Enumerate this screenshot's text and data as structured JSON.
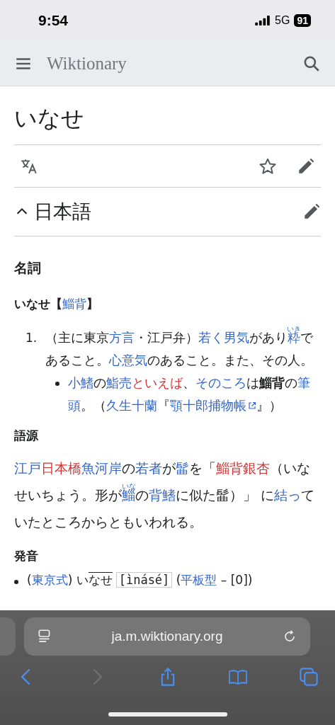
{
  "status_bar": {
    "time": "9:54",
    "network": "5G",
    "battery": "91"
  },
  "header": {
    "title": "Wiktionary"
  },
  "page": {
    "title": "いなせ"
  },
  "section": {
    "heading": "日本語",
    "expanded": true
  },
  "pos_heading": "名詞",
  "headword": [
    {
      "kind": "bold",
      "text": "いなせ【"
    },
    {
      "kind": "link",
      "text": "鯔背"
    },
    {
      "kind": "bold",
      "text": "】"
    }
  ],
  "definitions": [
    {
      "number": "1.",
      "segments": [
        {
          "kind": "text",
          "text": "（主に東京"
        },
        {
          "kind": "link",
          "text": "方言"
        },
        {
          "kind": "text",
          "text": "・江戸弁）"
        },
        {
          "kind": "link",
          "text": "若く男気"
        },
        {
          "kind": "text",
          "text": "があり"
        },
        {
          "kind": "link",
          "text": "粋",
          "ruby": "いき"
        },
        {
          "kind": "text",
          "text": "であること。"
        },
        {
          "kind": "link",
          "text": "心意気"
        },
        {
          "kind": "text",
          "text": "のあること。また、その人。"
        }
      ],
      "examples": [
        [
          {
            "kind": "link",
            "text": "小鰭"
          },
          {
            "kind": "text",
            "text": "の"
          },
          {
            "kind": "link",
            "text": "鮨売"
          },
          {
            "kind": "redlink",
            "text": "といえば"
          },
          {
            "kind": "text",
            "text": "、"
          },
          {
            "kind": "link",
            "text": "そのころ"
          },
          {
            "kind": "text",
            "text": "は"
          },
          {
            "kind": "bold",
            "text": "鯔背"
          },
          {
            "kind": "text",
            "text": "の"
          },
          {
            "kind": "link",
            "text": "筆"
          },
          {
            "kind": "link",
            "text": "頭"
          },
          {
            "kind": "text",
            "text": "。（"
          },
          {
            "kind": "link",
            "text": "久生十蘭"
          },
          {
            "kind": "text",
            "text": "『"
          },
          {
            "kind": "extlink",
            "text": "顎十郎捕物帳"
          },
          {
            "kind": "text",
            "text": "』）"
          }
        ]
      ]
    }
  ],
  "etymology": {
    "heading": "語源",
    "segments": [
      {
        "kind": "link",
        "text": "江戸"
      },
      {
        "kind": "redlink",
        "text": "日本橋"
      },
      {
        "kind": "link",
        "text": "魚河岸"
      },
      {
        "kind": "text",
        "text": "の"
      },
      {
        "kind": "link",
        "text": "若者"
      },
      {
        "kind": "text",
        "text": "が"
      },
      {
        "kind": "link",
        "text": "髷"
      },
      {
        "kind": "text",
        "text": "を「"
      },
      {
        "kind": "redlink",
        "text": "鯔背銀杏"
      },
      {
        "kind": "text",
        "text": "（いなせいちょう。形が"
      },
      {
        "kind": "link",
        "text": "鯔",
        "ruby": "いな"
      },
      {
        "kind": "text",
        "text": "の"
      },
      {
        "kind": "link",
        "text": "背鰭"
      },
      {
        "kind": "text",
        "text": "に似た髷）」 に"
      },
      {
        "kind": "link",
        "text": "結っ"
      },
      {
        "kind": "text",
        "text": "ていたところからともいわれる。"
      }
    ]
  },
  "pronunciation": {
    "heading": "発音",
    "items": [
      [
        {
          "kind": "text",
          "text": "("
        },
        {
          "kind": "link",
          "text": "東京式"
        },
        {
          "kind": "text",
          "text": ") い"
        },
        {
          "kind": "overline",
          "text": "なせ"
        },
        {
          "kind": "ipa",
          "text": "[ìnásé]"
        },
        {
          "kind": "text",
          "text": " ("
        },
        {
          "kind": "link",
          "text": "平板型"
        },
        {
          "kind": "text",
          "text": " – [0])"
        }
      ]
    ]
  },
  "browser": {
    "url": "ja.m.wiktionary.org",
    "back_enabled": true,
    "forward_enabled": false
  }
}
